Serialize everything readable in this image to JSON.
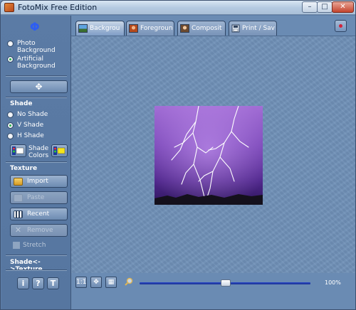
{
  "window": {
    "title": "FotoMix Free Edition",
    "minimize": "–",
    "maximize": "□",
    "close": "✕"
  },
  "left": {
    "logo": "Φ",
    "background_options": [
      {
        "label": "Photo Background",
        "checked": false
      },
      {
        "label": "Artificial Background",
        "checked": true
      }
    ],
    "move_button": "✥",
    "shade": {
      "title": "Shade",
      "options": [
        {
          "label": "No Shade",
          "checked": false
        },
        {
          "label": "V Shade",
          "checked": true
        },
        {
          "label": "H Shade",
          "checked": false
        }
      ],
      "colors_label": "Shade Colors"
    },
    "texture": {
      "title": "Texture",
      "import": "Import",
      "paste": "Paste",
      "recent": "Recent",
      "remove": "Remove",
      "stretch": "Stretch"
    },
    "footer_title": "Shade<->Texture",
    "footer_buttons": [
      "i",
      "?",
      "T"
    ]
  },
  "tabs": [
    {
      "label": "Backgrou",
      "icon": "landscape-icon",
      "active": true
    },
    {
      "label": "Foregroun",
      "icon": "portrait-icon",
      "active": false
    },
    {
      "label": "Composit",
      "icon": "composite-icon",
      "active": false
    },
    {
      "label": "Print / Sav",
      "icon": "print-save-icon",
      "active": false
    }
  ],
  "zoom": {
    "value": "100%",
    "slider_level": 0.5
  },
  "colors": {
    "panel": "#5b7ba5",
    "canvas": "#6f90b7",
    "accent": "#2d5df3"
  }
}
